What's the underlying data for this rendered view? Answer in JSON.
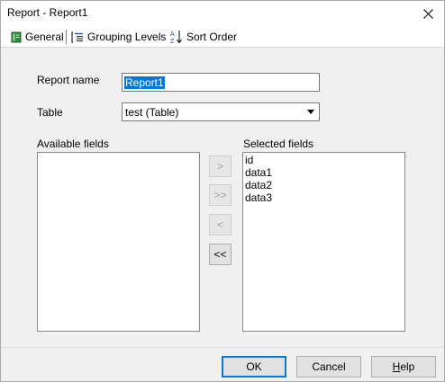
{
  "window": {
    "title": "Report - Report1"
  },
  "tabs": [
    {
      "label": "General",
      "icon": "book-icon"
    },
    {
      "label": "Grouping Levels",
      "icon": "grouping-icon"
    },
    {
      "label": "Sort Order",
      "icon": "sort-az-icon"
    }
  ],
  "form": {
    "report_name_label": "Report name",
    "report_name_value": "Report1",
    "table_label": "Table",
    "table_value": "test (Table)"
  },
  "available": {
    "label": "Available fields",
    "items": []
  },
  "selected": {
    "label": "Selected fields",
    "items": [
      "id",
      "data1",
      "data2",
      "data3"
    ]
  },
  "movers": {
    "add_one": ">",
    "add_all": ">>",
    "remove_one": "<",
    "remove_all": "<<"
  },
  "buttons": {
    "ok": "OK",
    "cancel": "Cancel",
    "help_prefix": "",
    "help_underlined": "H",
    "help_rest": "elp"
  },
  "colors": {
    "selection": "#0078d7",
    "default_button_border": "#0078d7",
    "dialog_background": "#f0f0f0"
  }
}
